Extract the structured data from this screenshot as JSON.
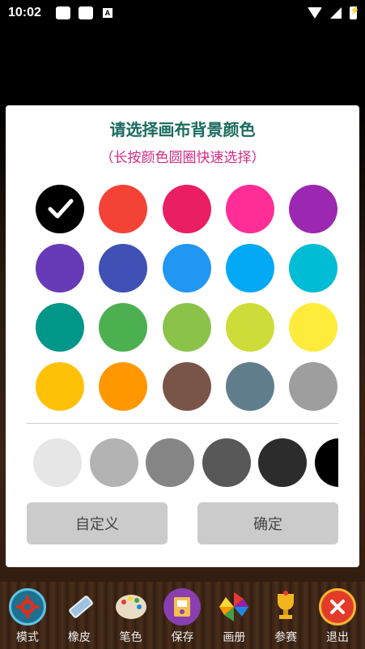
{
  "status_bar": {
    "time": "10:02",
    "a_icon": "A"
  },
  "dialog": {
    "title": "请选择画布背景颜色",
    "subtitle": "（长按颜色圆圈快速选择）",
    "colors": [
      "#000000",
      "#F44336",
      "#E91E63",
      "#FF2D95",
      "#9C27B0",
      "#673AB7",
      "#3F51B5",
      "#2196F3",
      "#03A9F4",
      "#00BCD4",
      "#009688",
      "#4CAF50",
      "#8BC34A",
      "#CDDC39",
      "#FFEB3B",
      "#FFC107",
      "#FF9800",
      "#795548",
      "#607D8B",
      "#9E9E9E"
    ],
    "selected_color": "#000000",
    "grays": [
      "#E6E6E6",
      "#B3B3B3",
      "#858585",
      "#585858",
      "#2C2C2C",
      "#000000"
    ],
    "custom_label": "自定义",
    "confirm_label": "确定"
  },
  "toolbar": {
    "items": [
      {
        "label": "模式",
        "icon": "gear-icon"
      },
      {
        "label": "橡皮",
        "icon": "eraser-icon"
      },
      {
        "label": "笔色",
        "icon": "palette-icon"
      },
      {
        "label": "保存",
        "icon": "save-icon"
      },
      {
        "label": "画册",
        "icon": "pinwheel-icon"
      },
      {
        "label": "参赛",
        "icon": "trophy-icon"
      },
      {
        "label": "退出",
        "icon": "close-icon"
      }
    ]
  }
}
